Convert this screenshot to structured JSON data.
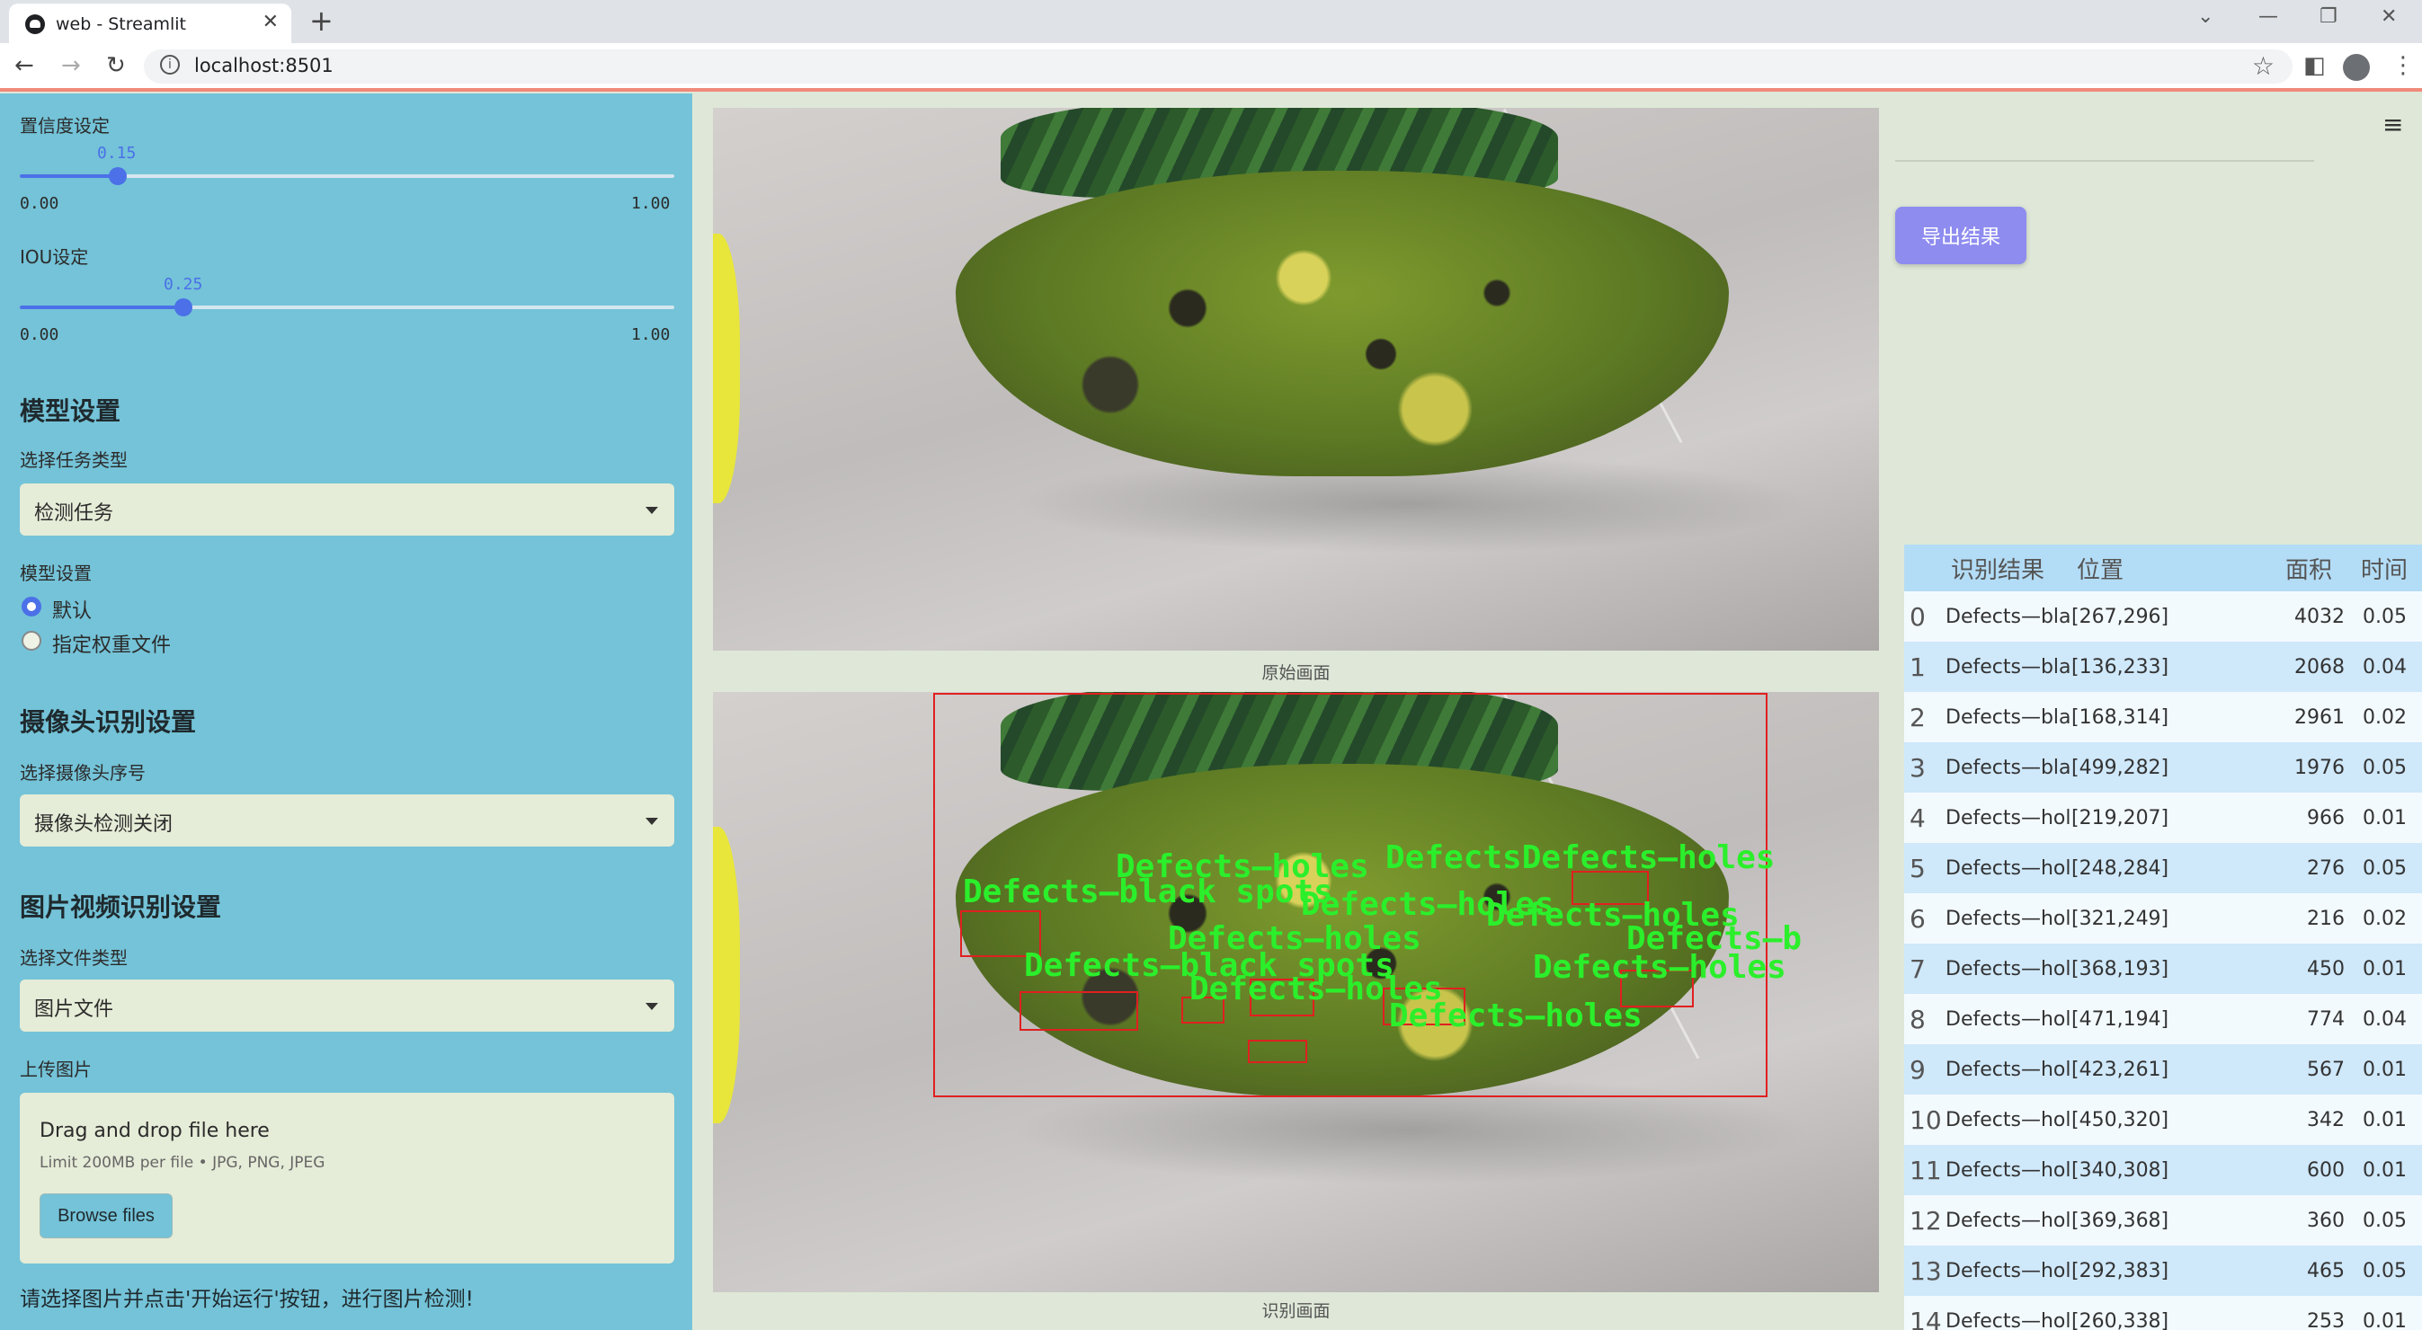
{
  "browser": {
    "tab_title": "web - Streamlit",
    "url": "localhost:8501"
  },
  "sidebar": {
    "confidence": {
      "label": "置信度设定",
      "value": "0.15",
      "value_num": 0.15,
      "min": "0.00",
      "max": "1.00"
    },
    "iou": {
      "label": "IOU设定",
      "value": "0.25",
      "value_num": 0.25,
      "min": "0.00",
      "max": "1.00"
    },
    "model_section": {
      "heading": "模型设置",
      "task_label": "选择任务类型",
      "task_value": "检测任务",
      "model_label": "模型设置",
      "options": [
        "默认",
        "指定权重文件"
      ],
      "selected_option": 0
    },
    "camera_section": {
      "heading": "摄像头识别设置",
      "camera_label": "选择摄像头序号",
      "camera_value": "摄像头检测关闭"
    },
    "media_section": {
      "heading": "图片视频识别设置",
      "file_type_label": "选择文件类型",
      "file_type_value": "图片文件",
      "upload_label": "上传图片",
      "drop_text": "Drag and drop file here",
      "limit_text": "Limit 200MB per file • JPG, PNG, JPEG",
      "browse_label": "Browse files"
    },
    "hint": "请选择图片并点击'开始运行'按钮，进行图片检测!"
  },
  "main": {
    "original_caption": "原始画面",
    "result_caption": "识别画面",
    "detection_labels": [
      "Defects—holes",
      "Defects—black spots",
      "Defects—holes",
      "DefectsDefects—holes",
      "Defects—holes",
      "Defects—holes",
      "Defects—b",
      "Defects—black spots",
      "Defects—holes",
      "Defects—holes",
      "Defects—holes"
    ]
  },
  "right": {
    "export_label": "导出结果",
    "table": {
      "headers": [
        "",
        "识别结果",
        "位置",
        "面积",
        "时间"
      ],
      "rows": [
        [
          "0",
          "Defects—black spots",
          "[267,296]",
          "4032",
          "0.05"
        ],
        [
          "1",
          "Defects—black spots",
          "[136,233]",
          "2068",
          "0.04"
        ],
        [
          "2",
          "Defects—black spots",
          "[168,314]",
          "2961",
          "0.02"
        ],
        [
          "3",
          "Defects—black spots",
          "[499,282]",
          "1976",
          "0.05"
        ],
        [
          "4",
          "Defects—holes",
          "[219,207]",
          "966",
          "0.01"
        ],
        [
          "5",
          "Defects—holes",
          "[248,284]",
          "276",
          "0.05"
        ],
        [
          "6",
          "Defects—holes",
          "[321,249]",
          "216",
          "0.02"
        ],
        [
          "7",
          "Defects—holes",
          "[368,193]",
          "450",
          "0.01"
        ],
        [
          "8",
          "Defects—holes",
          "[471,194]",
          "774",
          "0.04"
        ],
        [
          "9",
          "Defects—holes",
          "[423,261]",
          "567",
          "0.01"
        ],
        [
          "10",
          "Defects—holes",
          "[450,320]",
          "342",
          "0.01"
        ],
        [
          "11",
          "Defects—holes",
          "[340,308]",
          "600",
          "0.01"
        ],
        [
          "12",
          "Defects—holes",
          "[369,368]",
          "360",
          "0.05"
        ],
        [
          "13",
          "Defects—holes",
          "[292,383]",
          "465",
          "0.05"
        ],
        [
          "14",
          "Defects—holes",
          "[260,338]",
          "253",
          "0.01"
        ]
      ]
    }
  },
  "colors": {
    "sidebar_bg": "#74c3d8",
    "accent": "#4b70e8",
    "export_button": "#8e8cef",
    "detection_box": "#e02020",
    "detection_text": "#2bef2b"
  }
}
